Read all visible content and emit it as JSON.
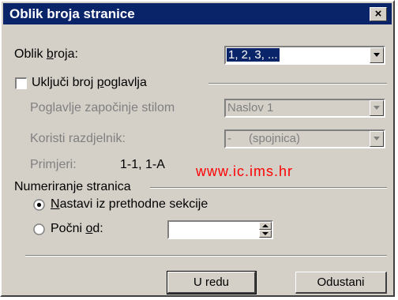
{
  "title": "Oblik broja stranice",
  "close_label": "×",
  "number_format": {
    "label_pre": "Oblik ",
    "label_u": "b",
    "label_post": "roja:",
    "value": "1, 2, 3, ..."
  },
  "include_chapter": {
    "label_pre": "Uključi broj ",
    "label_u": "p",
    "label_post": "oglavlja",
    "checked": false
  },
  "chapter_style": {
    "label": "Poglavlje započinje stilom",
    "value": "Naslov 1"
  },
  "separator": {
    "label": "Koristi razdjelnik:",
    "value_dash": "-",
    "value_name": "(spojnica)"
  },
  "examples": {
    "label": "Primjeri:",
    "value": "1-1, 1-A"
  },
  "watermark": "www.ic.ims.hr",
  "numbering": {
    "group_label": "Numeriranje stranica",
    "continue": {
      "label_u": "N",
      "label_post": "astavi iz prethodne sekcije",
      "selected": true
    },
    "start_at": {
      "label_pre": "Počni ",
      "label_u": "o",
      "label_post": "d:",
      "selected": false,
      "value": ""
    }
  },
  "buttons": {
    "ok": "U redu",
    "cancel": "Odustani"
  },
  "colors": {
    "titlebar": "#0a246a",
    "dialog_bg": "#d4d0c8",
    "watermark": "#ff0000"
  }
}
